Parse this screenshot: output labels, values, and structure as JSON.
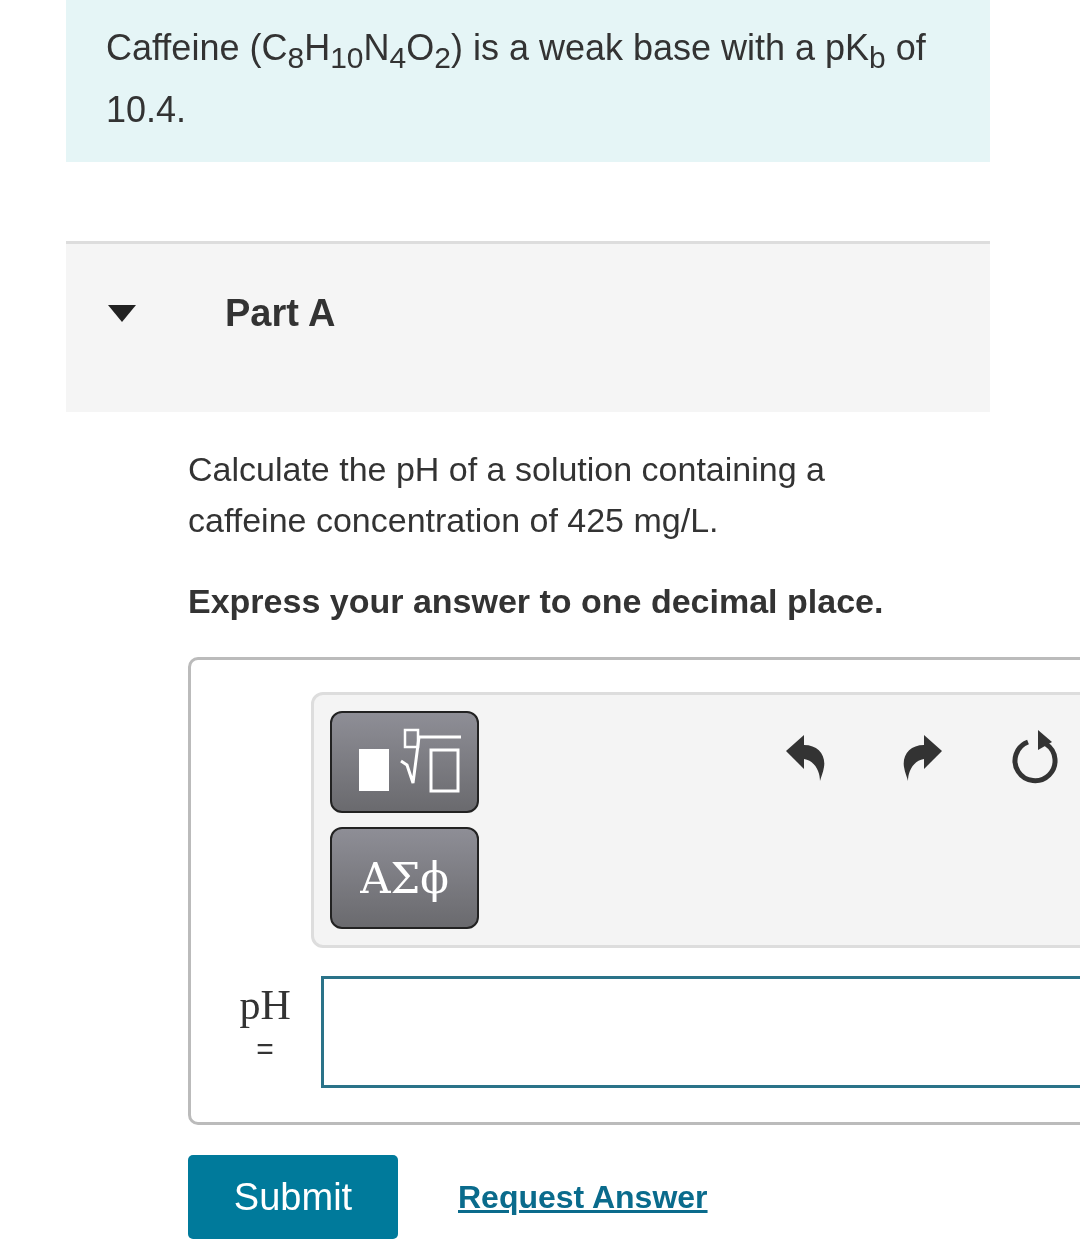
{
  "intro": "Caffeine (C$_{8}$H$_{10}$N$_{4}$O$_{2}$) is a weak base with a pK$_{b}$ of 10.4.",
  "part": {
    "title": "Part A",
    "expanded": true
  },
  "question": "Calculate the pH of a solution containing a caffeine concentration of 425 mg/L.",
  "instruction": "Express your answer to one decimal place.",
  "toolbar": {
    "symbols_button": "ΑΣϕ"
  },
  "answer": {
    "label": "pH",
    "equals": "="
  },
  "buttons": {
    "submit": "Submit",
    "request": "Request Answer"
  }
}
